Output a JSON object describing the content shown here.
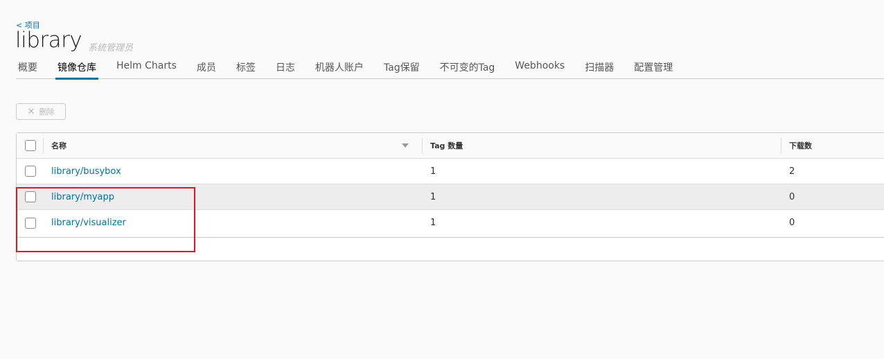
{
  "breadcrumb": "< 项目",
  "title": "library",
  "role": "系统管理员",
  "tabs": [
    "概要",
    "镜像仓库",
    "Helm Charts",
    "成员",
    "标签",
    "日志",
    "机器人账户",
    "Tag保留",
    "不可变的Tag",
    "Webhooks",
    "扫描器",
    "配置管理"
  ],
  "active_tab": 1,
  "delete_label": "删除",
  "columns": {
    "name": "名称",
    "tags": "Tag 数量",
    "downloads": "下载数"
  },
  "rows": [
    {
      "name": "library/busybox",
      "tags": "1",
      "downloads": "2"
    },
    {
      "name": "library/myapp",
      "tags": "1",
      "downloads": "0"
    },
    {
      "name": "library/visualizer",
      "tags": "1",
      "downloads": "0"
    }
  ]
}
